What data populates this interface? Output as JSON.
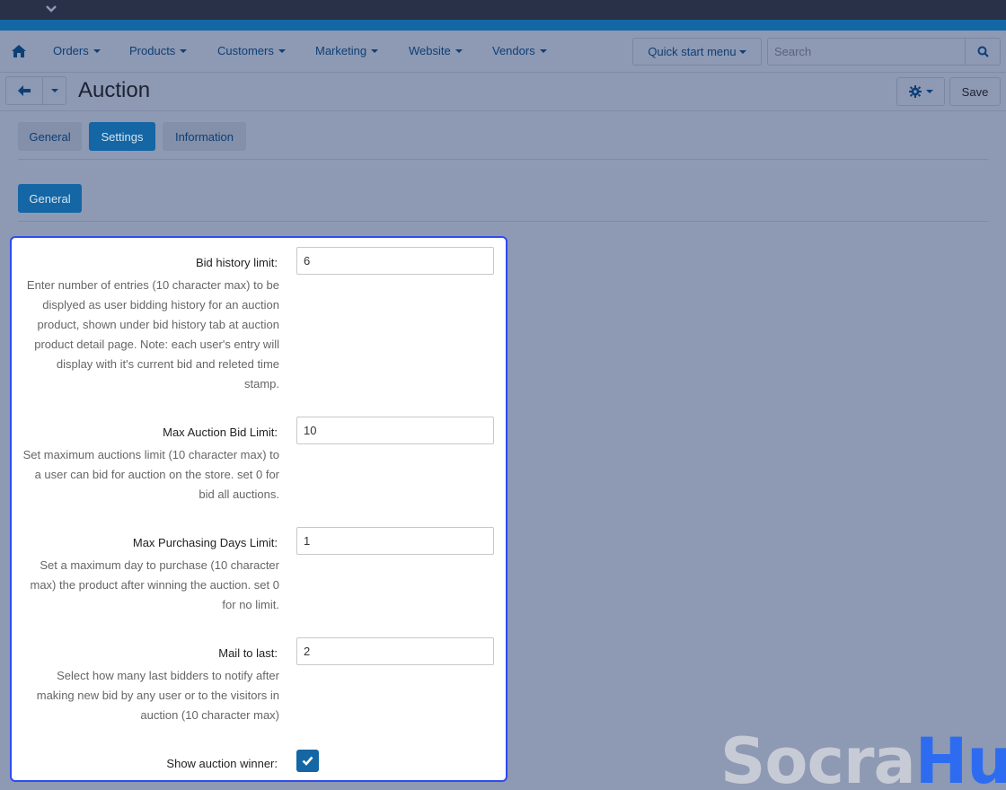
{
  "nav": {
    "items": [
      {
        "label": "Orders"
      },
      {
        "label": "Products"
      },
      {
        "label": "Customers"
      },
      {
        "label": "Marketing"
      },
      {
        "label": "Website"
      },
      {
        "label": "Vendors"
      }
    ],
    "quick_start_label": "Quick start menu",
    "search_placeholder": "Search"
  },
  "header": {
    "title": "Auction",
    "save_label": "Save"
  },
  "tabs": [
    {
      "label": "General",
      "active": false
    },
    {
      "label": "Settings",
      "active": true
    },
    {
      "label": "Information",
      "active": false
    }
  ],
  "section": {
    "label": "General"
  },
  "form": {
    "fields": [
      {
        "label": "Bid history limit:",
        "value": "6",
        "description": "Enter number of entries (10 character max) to be displyed as user bidding history for an auction product, shown under bid history tab at auction product detail page. Note: each user's entry will display with it's current bid and releted time stamp."
      },
      {
        "label": "Max Auction Bid Limit:",
        "value": "10",
        "description": "Set maximum auctions limit (10 character max) to a user can bid for auction on the store. set 0 for bid all auctions."
      },
      {
        "label": "Max Purchasing Days Limit:",
        "value": "1",
        "description": "Set a maximum day to purchase (10 character max) the product after winning the auction. set 0 for no limit."
      },
      {
        "label": "Mail to last:",
        "value": "2",
        "description": "Select how many last bidders to notify after making new bid by any user or to the visitors in auction (10 character max)"
      }
    ],
    "show_winner": {
      "label": "Show auction winner:",
      "checked": true
    }
  },
  "watermark": {
    "part1": "Socra",
    "part2": "Hub"
  },
  "colors": {
    "accent": "#1466a4",
    "highlight_border": "#2e4bf0",
    "overlay_bg": "#8e99b3"
  }
}
